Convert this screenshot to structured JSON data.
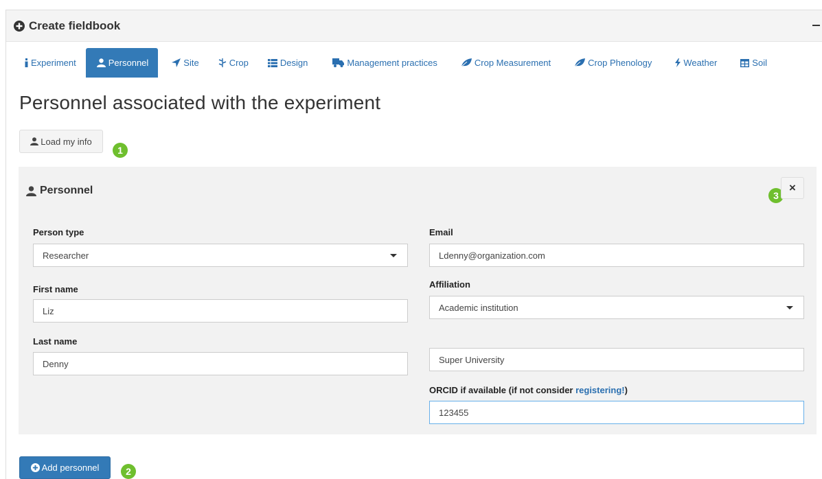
{
  "box": {
    "title": "Create fieldbook"
  },
  "tabs": [
    {
      "label": "Experiment",
      "icon": "info-icon"
    },
    {
      "label": "Personnel",
      "icon": "user-icon",
      "active": true
    },
    {
      "label": "Site",
      "icon": "location-arrow-icon"
    },
    {
      "label": "Crop",
      "icon": "pagelines-icon"
    },
    {
      "label": "Design",
      "icon": "th-list-icon"
    },
    {
      "label": "Management practices",
      "icon": "truck-icon"
    },
    {
      "label": "Crop Measurement",
      "icon": "leaf-icon"
    },
    {
      "label": "Crop Phenology",
      "icon": "leaf-icon"
    },
    {
      "label": "Weather",
      "icon": "bolt-icon"
    },
    {
      "label": "Soil",
      "icon": "table-icon"
    }
  ],
  "page": {
    "title": "Personnel associated with the experiment"
  },
  "load_button": {
    "label": "Load my info"
  },
  "annotations": {
    "one": "1",
    "two": "2",
    "three": "3"
  },
  "panel": {
    "title": "Personnel",
    "close_label": "×",
    "person_type": {
      "label": "Person type",
      "value": "Researcher"
    },
    "first_name": {
      "label": "First name",
      "value": "Liz"
    },
    "last_name": {
      "label": "Last name",
      "value": "Denny"
    },
    "email": {
      "label": "Email",
      "value": "Ldenny@organization.com"
    },
    "affiliation": {
      "label": "Affiliation",
      "value": "Academic institution"
    },
    "institution": {
      "value": "Super University"
    },
    "orcid": {
      "label_prefix": "ORCID if available (if not consider ",
      "link": "registering!",
      "label_suffix": ")",
      "value": "123455"
    }
  },
  "add_button": {
    "label": "Add personnel"
  },
  "colors": {
    "primary": "#337ab7",
    "badge": "#6fbf2e",
    "link": "#2a6fb0"
  }
}
